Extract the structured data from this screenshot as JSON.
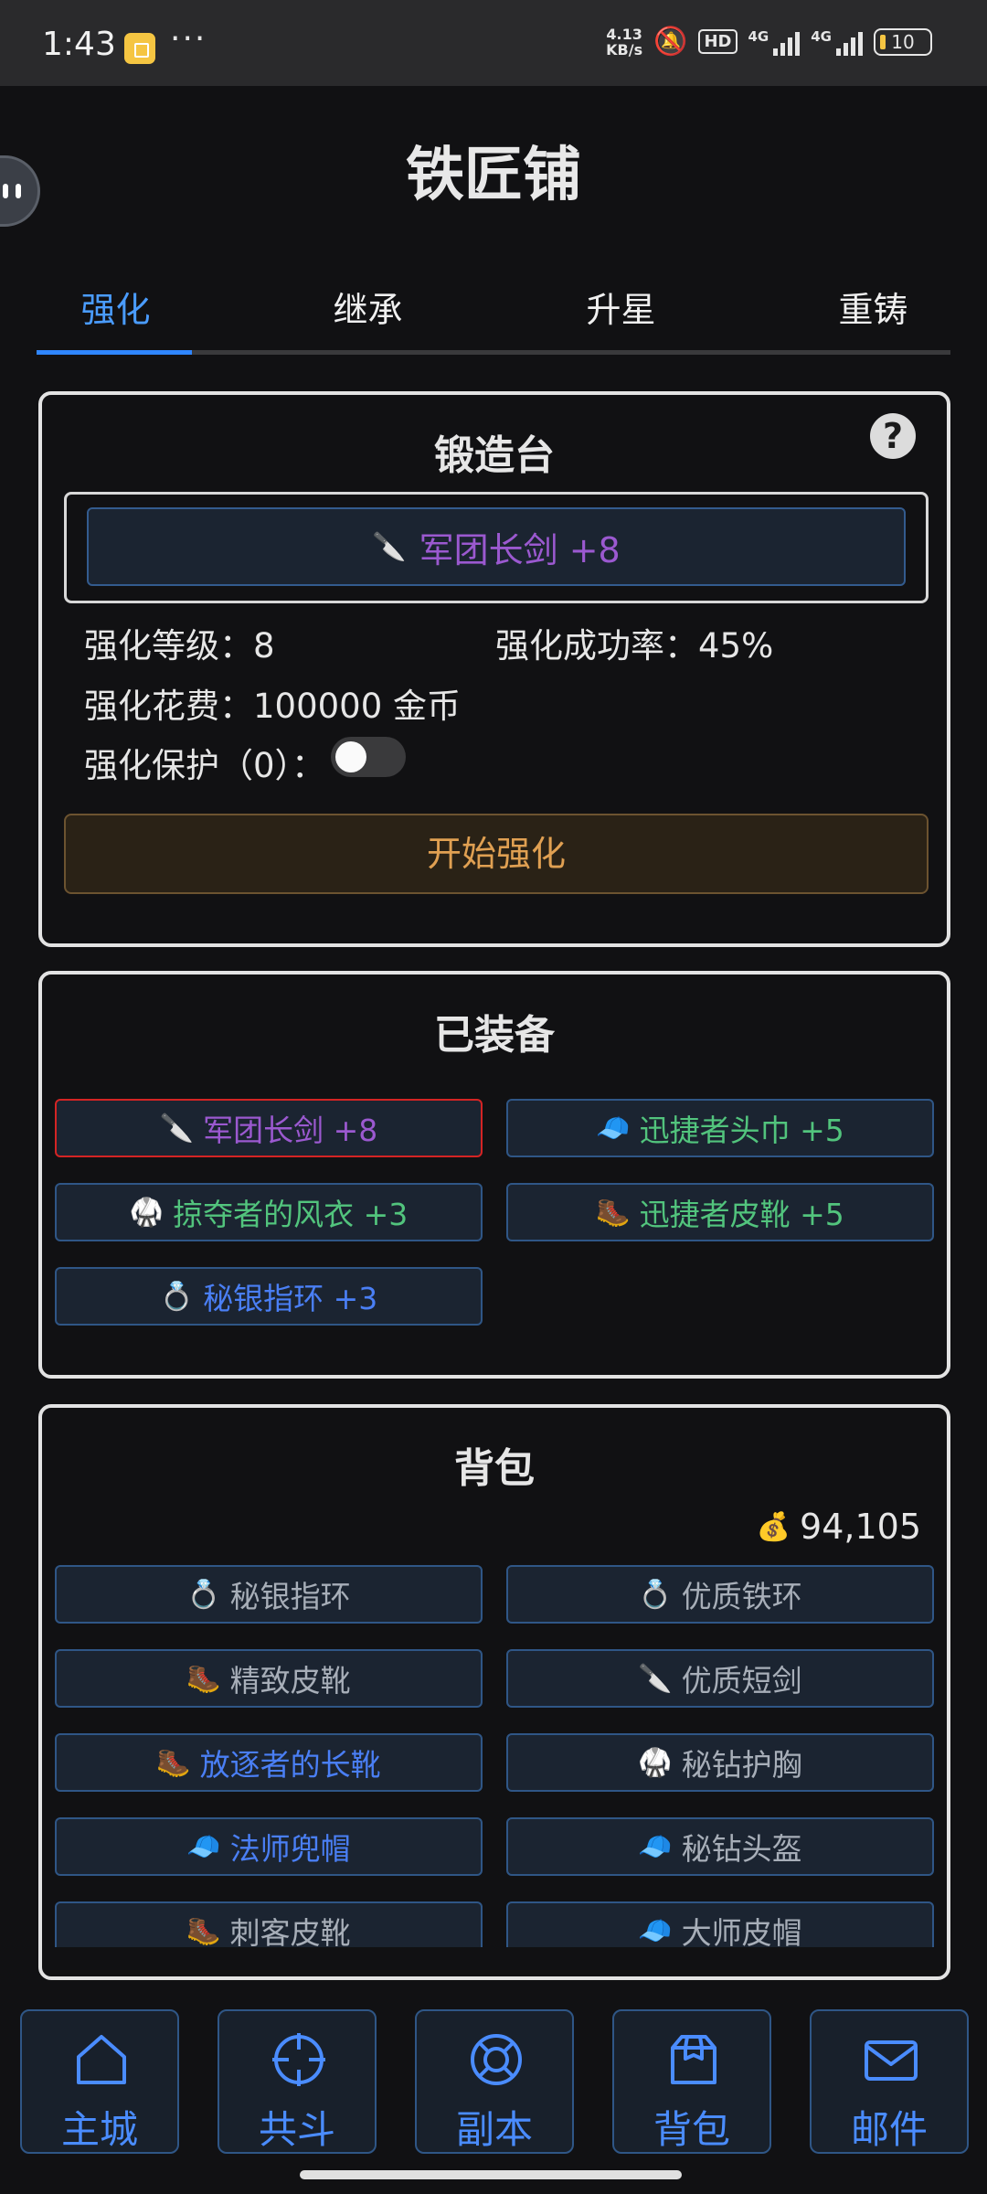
{
  "status_bar": {
    "time": "1:43",
    "more": "···",
    "speed_value": "4.13",
    "speed_unit": "KB/s",
    "hd_label": "HD",
    "network_1": "4G",
    "network_2": "4G",
    "battery": "10"
  },
  "title": "铁匠铺",
  "tabs": [
    {
      "label": "强化",
      "active": true
    },
    {
      "label": "继承"
    },
    {
      "label": "升星"
    },
    {
      "label": "重铸"
    }
  ],
  "forge": {
    "title": "锻造台",
    "help_label": "?",
    "selected_item": {
      "icon": "🔪",
      "name": "军团长剑 +8"
    },
    "level_label": "强化等级：8",
    "success_label": "强化成功率：45%",
    "cost_label": "强化花费：100000 金币",
    "protect_label": "强化保护（0）：",
    "protect_enabled": false,
    "start_button": "开始强化"
  },
  "equipped": {
    "title": "已装备",
    "items": [
      {
        "icon": "🔪",
        "name": "军团长剑 +8",
        "selected": true
      },
      {
        "icon": "🧢",
        "name": "迅捷者头巾 +5"
      },
      {
        "icon": "🥋",
        "name": "掠夺者的风衣 +3"
      },
      {
        "icon": "🥾",
        "name": "迅捷者皮靴 +5"
      },
      {
        "icon": "💍",
        "name": "秘银指环 +3"
      }
    ]
  },
  "bag": {
    "title": "背包",
    "gold_icon": "💰",
    "gold": "94,105",
    "items": [
      {
        "icon": "💍",
        "name": "秘银指环"
      },
      {
        "icon": "💍",
        "name": "优质铁环"
      },
      {
        "icon": "🥾",
        "name": "精致皮靴"
      },
      {
        "icon": "🔪",
        "name": "优质短剑"
      },
      {
        "icon": "🥾",
        "name": "放逐者的长靴"
      },
      {
        "icon": "🥋",
        "name": "秘钻护胸"
      },
      {
        "icon": "🧢",
        "name": "法师兜帽"
      },
      {
        "icon": "🧢",
        "name": "秘钻头盔"
      },
      {
        "icon": "🥾",
        "name": "刺客皮靴"
      },
      {
        "icon": "🧢",
        "name": "大师皮帽"
      }
    ]
  },
  "nav": [
    {
      "label": "主城"
    },
    {
      "label": "共斗"
    },
    {
      "label": "副本"
    },
    {
      "label": "背包"
    },
    {
      "label": "邮件"
    }
  ],
  "colors": {
    "accent": "#2f86ff",
    "rarity_purple": "#9b59d0",
    "rarity_green": "#52c47d",
    "rarity_blue": "#4a7ff5",
    "rarity_common": "#a7aeb8",
    "selected_border": "#d42424",
    "start_button": "#e0a052"
  }
}
